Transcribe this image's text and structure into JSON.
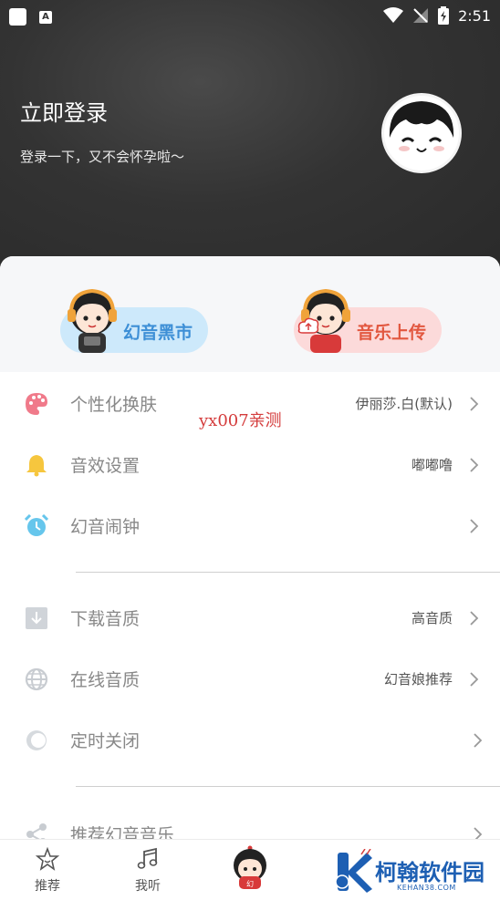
{
  "status_bar": {
    "time": "2:51"
  },
  "header": {
    "title": "立即登录",
    "subtitle": "登录一下，又不会怀孕啦～"
  },
  "features": [
    {
      "label": "幻音黑市",
      "color": "#3d8fd6"
    },
    {
      "label": "音乐上传",
      "color": "#e2573f"
    }
  ],
  "settings": {
    "group1": [
      {
        "label": "个性化换肤",
        "value": "伊丽莎.白(默认)",
        "icon": "palette-icon"
      },
      {
        "label": "音效设置",
        "value": "嘟嘟噜",
        "icon": "bell-icon"
      },
      {
        "label": "幻音闹钟",
        "value": "",
        "icon": "alarm-clock-icon"
      }
    ],
    "group2": [
      {
        "label": "下载音质",
        "value": "高音质",
        "icon": "download-icon"
      },
      {
        "label": "在线音质",
        "value": "幻音娘推荐",
        "icon": "globe-icon"
      },
      {
        "label": "定时关闭",
        "value": "",
        "icon": "timer-toggle-icon"
      }
    ],
    "group3": [
      {
        "label": "推荐幻音音乐",
        "value": "",
        "icon": "share-icon"
      }
    ]
  },
  "watermark": "yx007亲测",
  "bottom_nav": {
    "recommend": "推荐",
    "listen": "我听"
  },
  "brand": {
    "name": "柯翰软件园",
    "url_text": "KEHAN38.COM"
  }
}
